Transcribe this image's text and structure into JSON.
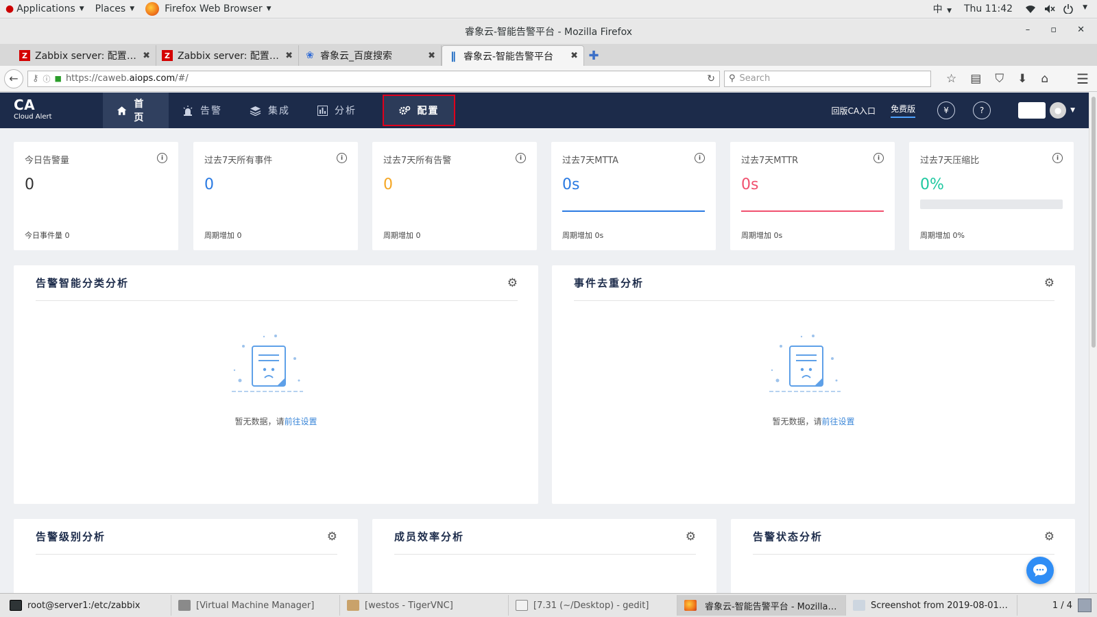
{
  "gnome": {
    "applications": "Applications",
    "places": "Places",
    "active_app": "Firefox Web Browser",
    "input_method": "中",
    "clock": "Thu 11:42"
  },
  "window": {
    "title": "睿象云-智能告警平台 - Mozilla Firefox"
  },
  "tabs": [
    {
      "label": "Zabbix server: 配置主...",
      "favicon": "Z"
    },
    {
      "label": "Zabbix server: 配置主...",
      "favicon": "Z"
    },
    {
      "label": "睿象云_百度搜索",
      "favicon": "paw"
    },
    {
      "label": "睿象云-智能告警平台",
      "favicon": "ca"
    }
  ],
  "navbar": {
    "url_prefix": "https://caweb.",
    "url_domain": "aiops.com",
    "url_suffix": "/#/",
    "search_placeholder": "Search"
  },
  "app": {
    "brand": "CA",
    "brand_sub": "Cloud Alert",
    "nav": [
      {
        "label": "首页",
        "icon": "home-icon"
      },
      {
        "label": "告警",
        "icon": "alarm-icon"
      },
      {
        "label": "集成",
        "icon": "layers-icon"
      },
      {
        "label": "分析",
        "icon": "chart-icon"
      },
      {
        "label": "配置",
        "icon": "gear-icon"
      }
    ],
    "old_version": "回版CA入口",
    "free": "免费版",
    "accent": "#1c2b4a"
  },
  "stats": [
    {
      "title": "今日告警量",
      "value": "0",
      "foot": "今日事件量 0",
      "color": "#333333"
    },
    {
      "title": "过去7天所有事件",
      "value": "0",
      "foot": "周期增加 0",
      "color": "#2a7ae2"
    },
    {
      "title": "过去7天所有告警",
      "value": "0",
      "foot": "周期增加 0",
      "color": "#f5a623"
    },
    {
      "title": "过去7天MTTA",
      "value": "0s",
      "foot": "周期增加 0s",
      "color": "#2a7ae2"
    },
    {
      "title": "过去7天MTTR",
      "value": "0s",
      "foot": "周期增加 0s",
      "color": "#f0506e"
    },
    {
      "title": "过去7天压缩比",
      "value": "0%",
      "foot": "周期增加 0%",
      "color": "#1ec8a0",
      "progress": 0
    }
  ],
  "panels": {
    "classify": "告警智能分类分析",
    "dedup": "事件去重分析",
    "level": "告警级别分析",
    "efficiency": "成员效率分析",
    "status": "告警状态分析"
  },
  "empty": {
    "text": "暂无数据，请",
    "link": "前往设置"
  },
  "taskbar": [
    {
      "label": "root@server1:/etc/zabbix"
    },
    {
      "label": "[Virtual Machine Manager]"
    },
    {
      "label": "[westos - TigerVNC]"
    },
    {
      "label": "[7.31 (~/Desktop) - gedit]"
    },
    {
      "label": "睿象云-智能告警平台 - Mozilla ..."
    },
    {
      "label": "Screenshot from 2019-08-01 ..."
    }
  ],
  "workspace": "1 / 4"
}
